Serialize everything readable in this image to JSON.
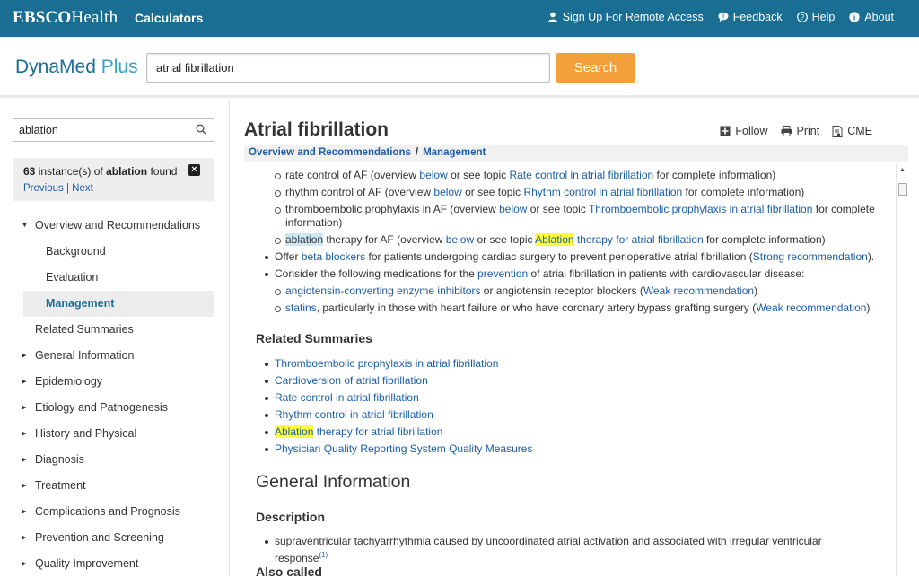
{
  "topbar": {
    "brand_bold": "EBSCO",
    "brand_rest": "Health",
    "calculators": "Calculators",
    "links": [
      {
        "label": "Sign Up For Remote Access",
        "icon": "user-icon"
      },
      {
        "label": "Feedback",
        "icon": "speech-bubble-icon"
      },
      {
        "label": "Help",
        "icon": "question-circle-icon"
      },
      {
        "label": "About",
        "icon": "info-circle-icon"
      }
    ]
  },
  "header": {
    "logo_main": "DynaMed",
    "logo_plus": "Plus",
    "search_value": "atrial fibrillation",
    "search_button": "Search"
  },
  "sidebar": {
    "find_value": "ablation",
    "find_count": "63",
    "find_text_pre": "instance(s) of",
    "find_term": "ablation",
    "find_text_post": "found",
    "previous": "Previous",
    "next": "Next",
    "toc": [
      {
        "label": "Overview and Recommendations",
        "expanded": true
      },
      {
        "label": "Background",
        "sub": true
      },
      {
        "label": "Evaluation",
        "sub": true
      },
      {
        "label": "Management",
        "sub": true,
        "active": true
      },
      {
        "label": "Related Summaries"
      },
      {
        "label": "General Information"
      },
      {
        "label": "Epidemiology"
      },
      {
        "label": "Etiology and Pathogenesis"
      },
      {
        "label": "History and Physical"
      },
      {
        "label": "Diagnosis"
      },
      {
        "label": "Treatment"
      },
      {
        "label": "Complications and Prognosis"
      },
      {
        "label": "Prevention and Screening"
      },
      {
        "label": "Quality Improvement"
      }
    ]
  },
  "main": {
    "title": "Atrial fibrillation",
    "actions": {
      "follow": "Follow",
      "print": "Print",
      "cme": "CME"
    },
    "breadcrumb": {
      "section": "Overview and Recommendations",
      "sep": "/",
      "current": "Management"
    },
    "content": {
      "l1": {
        "a": "rate control of AF (overview ",
        "b": "below",
        "c": " or see topic ",
        "d": "Rate control in atrial fibrillation",
        "e": " for complete information)"
      },
      "l2": {
        "a": "rhythm control of AF (overview ",
        "b": "below",
        "c": " or see topic ",
        "d": "Rhythm control in atrial fibrillation",
        "e": " for complete information)"
      },
      "l3": {
        "a": "thromboembolic prophylaxis in AF (overview ",
        "b": "below",
        "c": " or see topic ",
        "d": "Thromboembolic prophylaxis in atrial fibrillation",
        "e": " for complete information)"
      },
      "l4": {
        "a": "ablation",
        "b": " therapy for AF (overview ",
        "c": "below",
        "d": " or see topic ",
        "e": "Ablation",
        "f": " therapy for atrial fibrillation",
        "g": " for complete information)"
      },
      "l5": {
        "a": "Offer ",
        "b": "beta blockers",
        "c": " for patients undergoing cardiac surgery to prevent perioperative atrial fibrillation (",
        "d": "Strong recommendation",
        "e": ")."
      },
      "l6": {
        "a": "Consider the following medications for the ",
        "b": "prevention",
        "c": " of atrial fibrillation in patients with cardiovascular disease:"
      },
      "l7": {
        "a": "angiotensin-converting enzyme inhibitors",
        "b": " or angiotensin receptor blockers (",
        "c": "Weak recommendation",
        "d": ")"
      },
      "l8": {
        "a": "statins",
        "b": ", particularly in those with heart failure or who have coronary artery bypass grafting surgery (",
        "c": "Weak recommendation",
        "d": ")"
      },
      "related_heading": "Related Summaries",
      "related": [
        "Thromboembolic prophylaxis in atrial fibrillation",
        "Cardioversion of atrial fibrillation",
        "Rate control in atrial fibrillation",
        "Rhythm control in atrial fibrillation"
      ],
      "related_ablation_hl": "Ablation",
      "related_ablation_rest": " therapy for atrial fibrillation",
      "related_last": "Physician Quality Reporting System Quality Measures",
      "general_heading": "General Information",
      "description_heading": "Description",
      "description_text": "supraventricular tachyarrhythmia caused by uncoordinated atrial activation and associated with irregular ventricular response",
      "description_ref": "(1)",
      "also_called_heading": "Also called"
    }
  }
}
